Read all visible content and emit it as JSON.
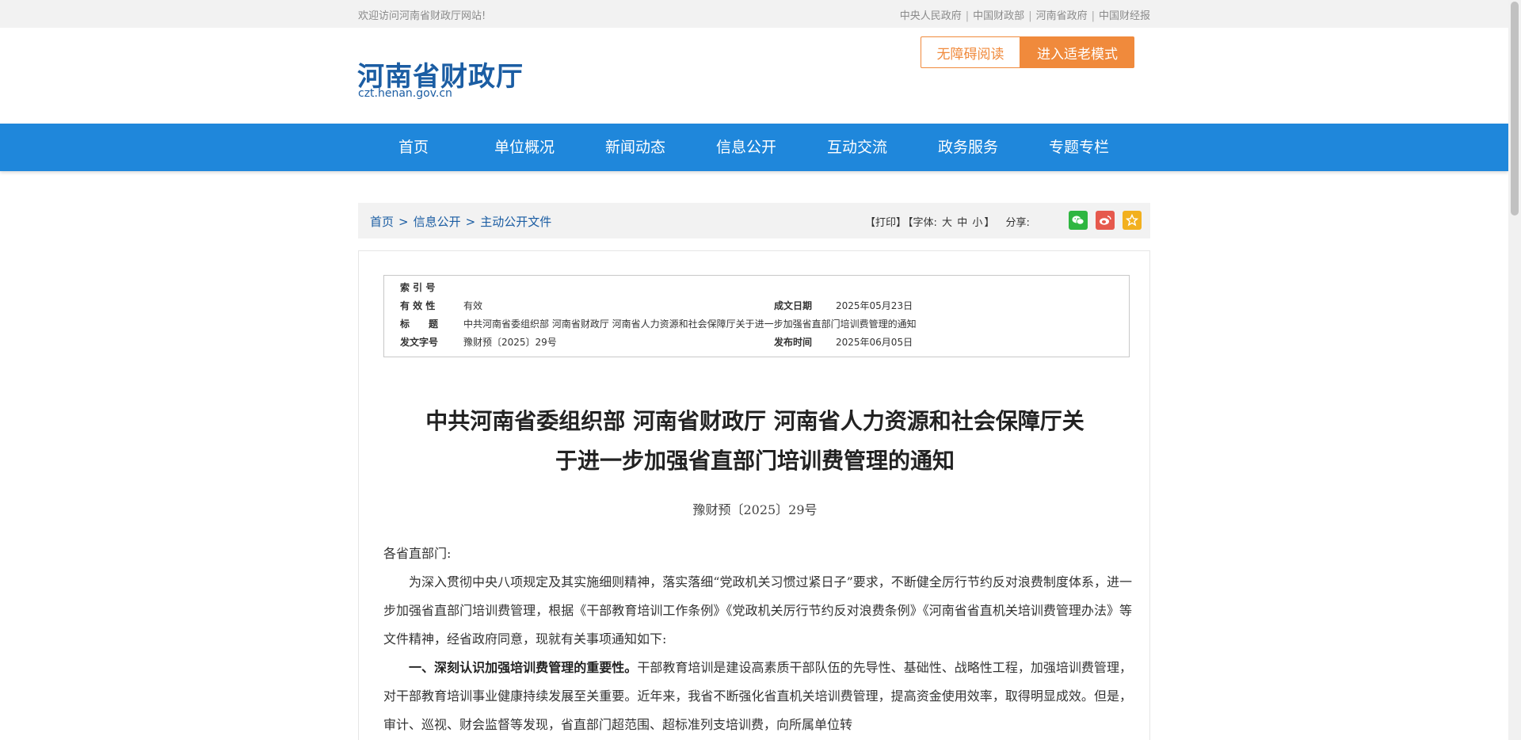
{
  "topbar": {
    "welcome": "欢迎访问河南省财政厅网站!",
    "links": [
      "中央人民政府",
      "中国财政部",
      "河南省政府",
      "中国财经报"
    ]
  },
  "header": {
    "site_title": "河南省财政厅",
    "site_url": "czt.henan.gov.cn",
    "accessibility_button": "无障碍阅读",
    "elder_mode_button": "进入适老模式"
  },
  "nav": {
    "items": [
      "首页",
      "单位概况",
      "新闻动态",
      "信息公开",
      "互动交流",
      "政务服务",
      "专题专栏"
    ]
  },
  "breadcrumb": {
    "items": [
      "首页",
      "信息公开",
      "主动公开文件"
    ],
    "separator": ">"
  },
  "tools": {
    "print": "【打印】",
    "font_label": "【字体:",
    "font_large": "大",
    "font_medium": "中",
    "font_small": "小",
    "font_end": "】",
    "share_label": "分享:",
    "share_icons": [
      "wechat-icon",
      "weibo-icon",
      "favorite-icon"
    ]
  },
  "meta": {
    "index_label": "索 引 号",
    "index_value": "",
    "validity_label": "有 效 性",
    "validity_value": "有效",
    "date_label": "成文日期",
    "date_value": "2025年05月23日",
    "title_label": "标　　题",
    "title_value": "中共河南省委组织部 河南省财政厅 河南省人力资源和社会保障厅关于进一步加强省直部门培训费管理的通知",
    "docno_label": "发文字号",
    "docno_value": "豫财预〔2025〕29号",
    "publish_label": "发布时间",
    "publish_value": "2025年06月05日"
  },
  "article": {
    "title_line1": "中共河南省委组织部 河南省财政厅 河南省人力资源和社会保障厅关",
    "title_line2": "于进一步加强省直部门培训费管理的通知",
    "doc_number": "豫财预〔2025〕29号",
    "salutation": "各省直部门:",
    "para1": "为深入贯彻中央八项规定及其实施细则精神，落实落细“党政机关习惯过紧日子”要求，不断健全厉行节约反对浪费制度体系，进一步加强省直部门培训费管理，根据《干部教育培训工作条例》《党政机关厉行节约反对浪费条例》《河南省省直机关培训费管理办法》等文件精神，经省政府同意，现就有关事项通知如下:",
    "para2_heading": "一、深刻认识加强培训费管理的重要性。",
    "para2_text": "干部教育培训是建设高素质干部队伍的先导性、基础性、战略性工程，加强培训费管理，对干部教育培训事业健康持续发展至关重要。近年来，我省不断强化省直机关培训费管理，提高资金使用效率，取得明显成效。但是，审计、巡视、财会监督等发现，省直部门超范围、超标准列支培训费，向所属单位转"
  },
  "colors": {
    "nav_blue": "#1f87db",
    "title_blue": "#1b5da3",
    "accent_orange": "#f08a3c"
  }
}
